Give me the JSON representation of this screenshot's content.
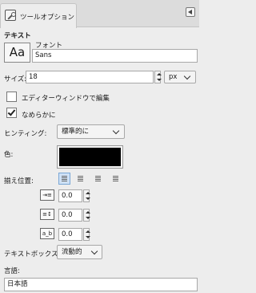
{
  "tab": {
    "label": "ツールオプション",
    "icon": "text-tool-icon"
  },
  "panel_menu_icon": "panel-menu-icon",
  "section_title": "テキスト",
  "font": {
    "label": "フォント",
    "preview": "Aa",
    "value": "Sans"
  },
  "size": {
    "label": "サイズ:",
    "value": "18",
    "unit": "px"
  },
  "editor_window": {
    "label": "エディターウィンドウで編集",
    "checked": false
  },
  "antialias": {
    "label": "なめらかに",
    "checked": true
  },
  "hinting": {
    "label": "ヒンティング:",
    "value": "標準的に"
  },
  "color": {
    "label": "色:",
    "value": "#000000"
  },
  "justify": {
    "label": "揃え位置:",
    "options": [
      "justify-left-icon",
      "justify-right-icon",
      "justify-center-icon",
      "justify-fill-icon"
    ],
    "active": 0
  },
  "indent": {
    "icon": "indent-icon",
    "value": "0.0"
  },
  "line_spacing": {
    "icon": "line-spacing-icon",
    "value": "0.0"
  },
  "letter_spacing": {
    "icon": "letter-spacing-icon",
    "icon_text": "a_b",
    "value": "0.0"
  },
  "text_box": {
    "label": "テキストボックス:",
    "value": "流動的"
  },
  "language": {
    "label": "言語:",
    "value": "日本語"
  }
}
